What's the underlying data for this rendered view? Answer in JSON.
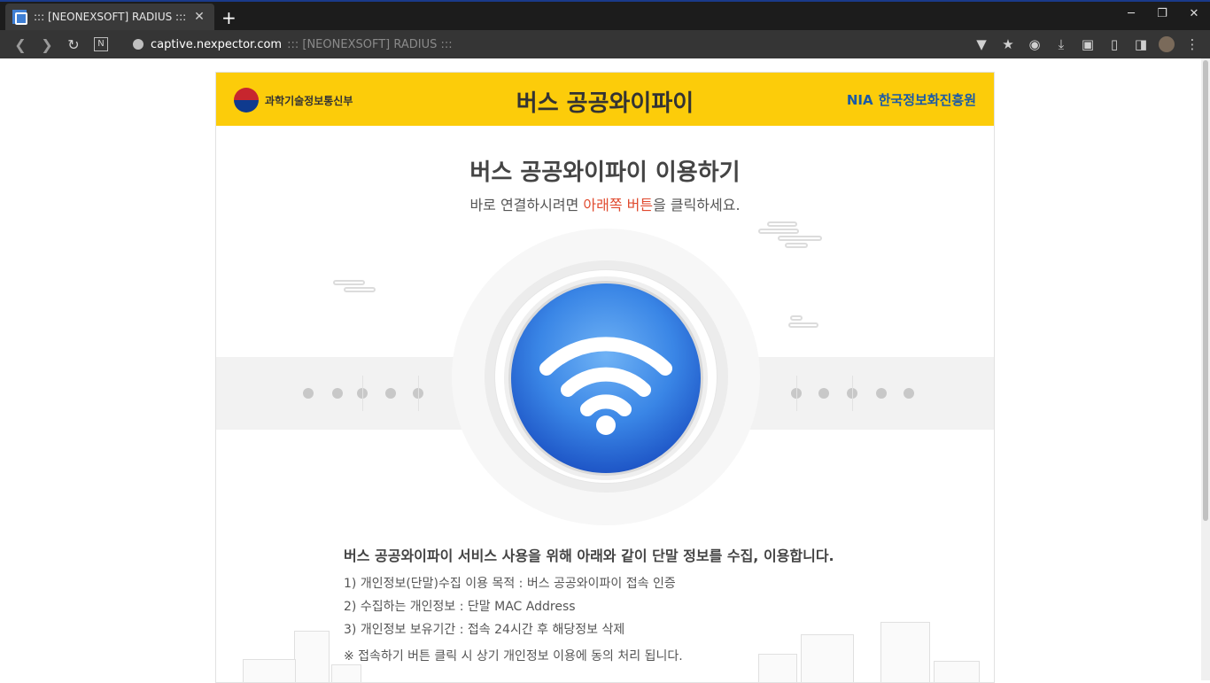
{
  "browser": {
    "tab_title": "::: [NEONEXSOFT] RADIUS :::",
    "tab_close": "✕",
    "new_tab": "+",
    "url_host": "captive.nexpector.com",
    "url_title": "::: [NEONEXSOFT] RADIUS :::",
    "n_label": "N",
    "window": {
      "minimize": "─",
      "restore": "❐",
      "close": "✕"
    }
  },
  "header": {
    "gov_name": "과학기술정보통신부",
    "title": "버스 공공와이파이",
    "nia_abbr": "NIA",
    "nia_name": "한국정보화진흥원"
  },
  "main": {
    "title": "버스 공공와이파이 이용하기",
    "subtitle_pre": "바로 연결하시려면 ",
    "subtitle_highlight": "아래쪽 버튼",
    "subtitle_post": "을 클릭하세요."
  },
  "info": {
    "heading": "버스 공공와이파이 서비스 사용을 위해 아래와 같이 단말 정보를 수집, 이용합니다.",
    "lines": [
      "1) 개인정보(단말)수집 이용 목적 : 버스 공공와이파이 접속 인증",
      "2) 수집하는 개인정보 : 단말 MAC Address",
      "3) 개인정보 보유기간 : 접속 24시간 후 해당정보 삭제"
    ],
    "note": "※ 접속하기 버튼 클릭 시 상기 개인정보 이용에 동의 처리 됩니다."
  },
  "colors": {
    "header_bg": "#fccc0a",
    "highlight": "#e04a2e",
    "nia_blue": "#1a5aa6",
    "wifi_blue": "#3a86e6"
  }
}
